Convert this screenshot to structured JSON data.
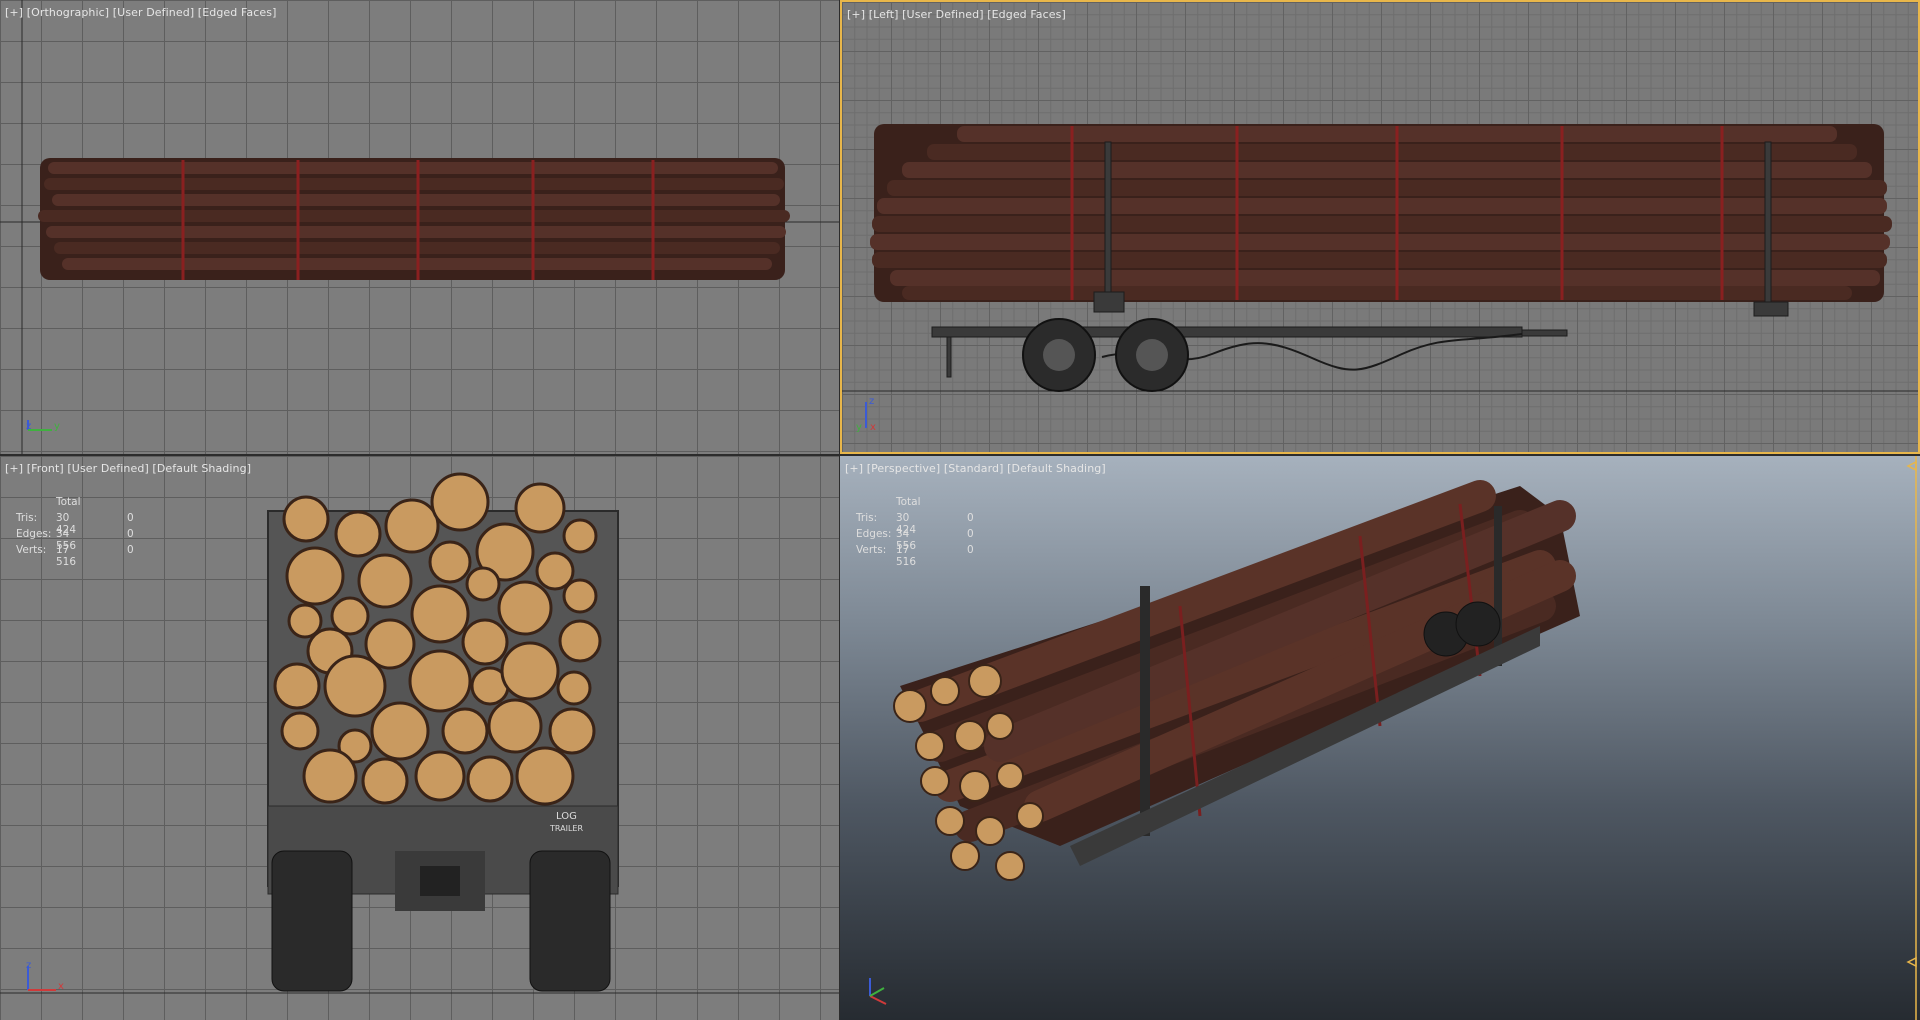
{
  "viewports": {
    "top_left": {
      "label": "[+] [Orthographic] [User Defined] [Edged Faces]"
    },
    "top_right": {
      "label": "[+] [Left] [User Defined] [Edged Faces]"
    },
    "bottom_left": {
      "label": "[+] [Front] [User Defined] [Default Shading]"
    },
    "bottom_right": {
      "label": "[+] [Perspective] [Standard] [Default Shading]"
    }
  },
  "stats": {
    "header": "Total",
    "rows": [
      {
        "label": "Tris:",
        "total": "30 424",
        "selected": "0"
      },
      {
        "label": "Edges:",
        "total": "34 556",
        "selected": "0"
      },
      {
        "label": "Verts:",
        "total": "17 516",
        "selected": "0"
      }
    ]
  },
  "axis": {
    "x": "x",
    "y": "y",
    "z": "z"
  },
  "trailer_text": {
    "line1": "LOG",
    "line2": "TRAILER"
  },
  "colors": {
    "wood": "#4a2a22",
    "log_end": "#c99a60",
    "strap": "#7a1f1f",
    "grid": "#7d7d7d",
    "active_border": "#e8b64a"
  }
}
